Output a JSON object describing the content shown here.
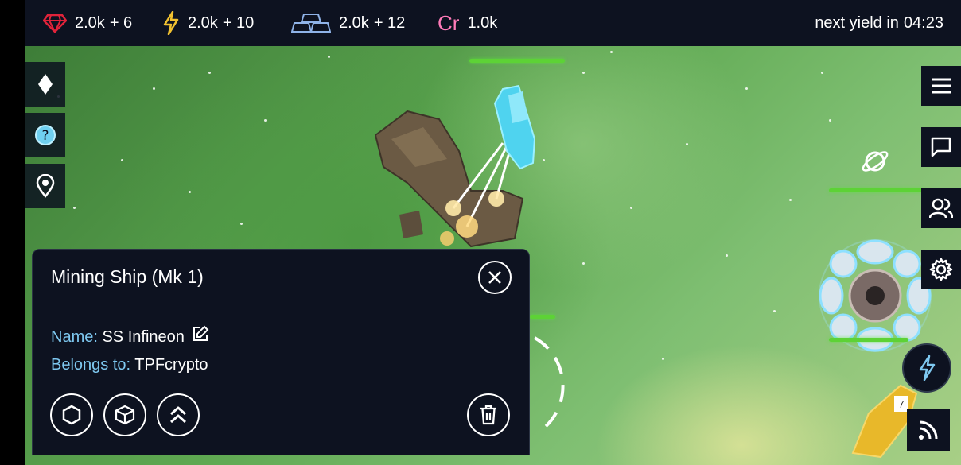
{
  "resources": [
    {
      "icon": "gem-icon",
      "amount": "2.0k",
      "increment": "+ 6"
    },
    {
      "icon": "energy-icon",
      "amount": "2.0k",
      "increment": "+ 10"
    },
    {
      "icon": "metal-bars-icon",
      "amount": "2.0k",
      "increment": "+ 12"
    },
    {
      "icon": "credits-icon",
      "symbol": "Cr",
      "amount": "1.0k"
    }
  ],
  "yield": {
    "label": "next yield in",
    "timer": "04:23"
  },
  "left_nav": [
    {
      "icon": "diamond-icon"
    },
    {
      "icon": "help-icon"
    },
    {
      "icon": "location-pin-icon"
    }
  ],
  "right_nav": [
    {
      "icon": "menu-icon"
    },
    {
      "icon": "chat-icon"
    },
    {
      "icon": "users-icon"
    },
    {
      "icon": "settings-icon"
    }
  ],
  "panel": {
    "title": "Mining Ship (Mk 1)",
    "name_label": "Name:",
    "name_value": "SS Infineon",
    "owner_label": "Belongs to:",
    "owner_value": "TPFcrypto",
    "actions": [
      "hexagon-icon",
      "cube-icon",
      "chevrons-up-icon"
    ],
    "delete_icon": "trash-icon"
  },
  "fleet_badge": "7",
  "colors": {
    "bar_bg": "#0d1220",
    "gem": "#e0233a",
    "energy": "#f2c230",
    "metal": "#8fb3e8",
    "credits": "#ff7ab8",
    "label_blue": "#7ec8f0",
    "health": "#5dd236"
  }
}
